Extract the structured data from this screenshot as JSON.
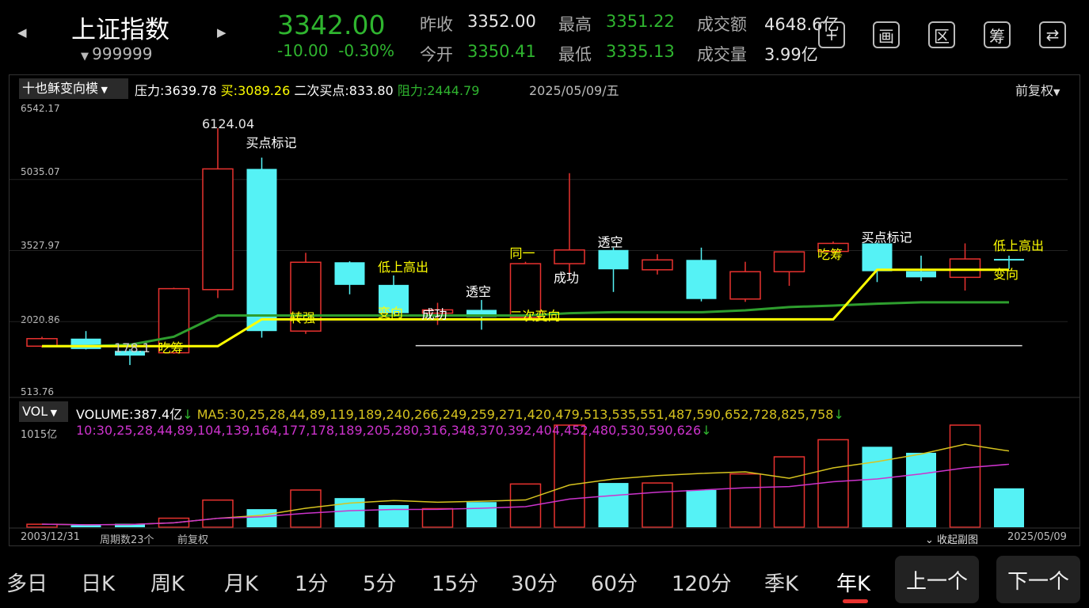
{
  "header": {
    "title": "上证指数",
    "code": "999999",
    "price": "3342.00",
    "change": "-10.00",
    "change_pct": "-0.30%",
    "prev_close_label": "昨收",
    "prev_close": "3352.00",
    "open_label": "今开",
    "open": "3350.41",
    "high_label": "最高",
    "high": "3351.22",
    "low_label": "最低",
    "low": "3335.13",
    "amount_label": "成交额",
    "amount": "4648.6亿",
    "volume_label": "成交量",
    "volume": "3.99亿",
    "toolbar_icons": [
      "plus-icon",
      "draw-icon",
      "range-icon",
      "chip-icon",
      "device-switch-icon"
    ],
    "toolbar_glyphs": [
      "+",
      "画",
      "区",
      "筹",
      "⇄"
    ]
  },
  "indicator": {
    "selector": "十也稣变向模",
    "pressure_label": "压力:",
    "pressure": "3639.78",
    "buy_label": "买:",
    "buy": "3089.26",
    "second_buy_label": "二次买点:",
    "second_buy": "833.80",
    "resistance_label": "阻力:",
    "resistance": "2444.79",
    "date": "2025/05/09/五",
    "adjust": "前复权"
  },
  "colors": {
    "up": "#e8322f",
    "down": "#55f2f5",
    "ma_green": "#2e9e2e",
    "yellow_line": "#ffff00",
    "ma5": "#d6c31f",
    "ma10": "#cc33cc"
  },
  "chart_data": [
    {
      "type": "candlestick",
      "title": "上证指数 年K",
      "y_ticks": [
        "6542.17",
        "5035.07",
        "3527.97",
        "2020.86",
        "513.76"
      ],
      "ylim": [
        513.76,
        6542.17
      ],
      "candles": [
        {
          "o": 1500,
          "c": 1660,
          "h": 1700,
          "l": 1470,
          "dir": "up"
        },
        {
          "o": 1660,
          "c": 1440,
          "h": 1820,
          "l": 1430,
          "dir": "down"
        },
        {
          "o": 1400,
          "c": 1300,
          "h": 1440,
          "l": 1100,
          "dir": "down"
        },
        {
          "o": 1360,
          "c": 2720,
          "h": 2740,
          "l": 1340,
          "dir": "up"
        },
        {
          "o": 2700,
          "c": 5260,
          "h": 6124,
          "l": 2520,
          "dir": "up"
        },
        {
          "o": 5260,
          "c": 1820,
          "h": 5500,
          "l": 1680,
          "dir": "down"
        },
        {
          "o": 1820,
          "c": 3280,
          "h": 3480,
          "l": 1760,
          "dir": "up"
        },
        {
          "o": 3280,
          "c": 2800,
          "h": 3300,
          "l": 2600,
          "dir": "down"
        },
        {
          "o": 2800,
          "c": 2200,
          "h": 3000,
          "l": 2140,
          "dir": "down"
        },
        {
          "o": 2200,
          "c": 2270,
          "h": 2420,
          "l": 1950,
          "dir": "up"
        },
        {
          "o": 2270,
          "c": 2120,
          "h": 2480,
          "l": 1850,
          "dir": "down"
        },
        {
          "o": 2110,
          "c": 3250,
          "h": 3290,
          "l": 2060,
          "dir": "up"
        },
        {
          "o": 3250,
          "c": 3540,
          "h": 5170,
          "l": 2950,
          "dir": "up"
        },
        {
          "o": 3540,
          "c": 3130,
          "h": 3590,
          "l": 2650,
          "dir": "down"
        },
        {
          "o": 3120,
          "c": 3330,
          "h": 3450,
          "l": 3020,
          "dir": "up"
        },
        {
          "o": 3330,
          "c": 2500,
          "h": 3590,
          "l": 2450,
          "dir": "down"
        },
        {
          "o": 2500,
          "c": 3080,
          "h": 3290,
          "l": 2440,
          "dir": "up"
        },
        {
          "o": 3080,
          "c": 3500,
          "h": 3500,
          "l": 2780,
          "dir": "up"
        },
        {
          "o": 3510,
          "c": 3680,
          "h": 3720,
          "l": 3460,
          "dir": "up"
        },
        {
          "o": 3680,
          "c": 3090,
          "h": 3700,
          "l": 2860,
          "dir": "down"
        },
        {
          "o": 3090,
          "c": 2960,
          "h": 3420,
          "l": 2880,
          "dir": "down"
        },
        {
          "o": 2960,
          "c": 3350,
          "h": 3680,
          "l": 2680,
          "dir": "up"
        },
        {
          "o": 3350,
          "c": 3342,
          "h": 3420,
          "l": 3140,
          "dir": "down"
        }
      ],
      "green_ma": [
        1500,
        1500,
        1530,
        1700,
        2150,
        2150,
        2150,
        2150,
        2150,
        2150,
        2150,
        2150,
        2200,
        2220,
        2220,
        2220,
        2260,
        2330,
        2360,
        2400,
        2430,
        2430,
        2430
      ],
      "yellow_line": [
        1500,
        1500,
        1500,
        1500,
        1500,
        2070,
        2070,
        2070,
        2070,
        2070,
        2070,
        2070,
        2070,
        2070,
        2070,
        2070,
        2070,
        2070,
        2070,
        3120,
        3120,
        3120,
        3120
      ],
      "signals": [
        {
          "i": 2,
          "text": "178.1",
          "color": "#cccccc",
          "value": 1370
        },
        {
          "i": 3,
          "text": "吃筹",
          "color": "#ffff00",
          "value": 1370
        },
        {
          "i": 4,
          "text": "6124.04",
          "color": "#e6e6e6",
          "value": 6124
        },
        {
          "i": 5,
          "text": "买点标记",
          "color": "#ffffff",
          "value": 5720
        },
        {
          "i": 6,
          "text": "转强",
          "color": "#ffff00",
          "value": 2010
        },
        {
          "i": 8,
          "text": "低上高出",
          "color": "#ffff00",
          "value": 3080
        },
        {
          "i": 8,
          "text": "变向",
          "color": "#ffff00",
          "value": 2120
        },
        {
          "i": 9,
          "text": "成功",
          "color": "#ffffff",
          "value": 2080
        },
        {
          "i": 10,
          "text": "透空",
          "color": "#ffffff",
          "value": 2560
        },
        {
          "i": 11,
          "text": "二次变向",
          "color": "#ffff00",
          "value": 2050
        },
        {
          "i": 11,
          "text": "同一",
          "color": "#ffff00",
          "value": 3380
        },
        {
          "i": 12,
          "text": "成功",
          "color": "#ffffff",
          "value": 2860
        },
        {
          "i": 13,
          "text": "透空",
          "color": "#ffffff",
          "value": 3610
        },
        {
          "i": 18,
          "text": "吃筹",
          "color": "#ffff00",
          "value": 3350
        },
        {
          "i": 19,
          "text": "买点标记",
          "color": "#ffffff",
          "value": 3710
        },
        {
          "i": 22,
          "text": "低上高出",
          "color": "#ffff00",
          "value": 3540
        },
        {
          "i": 22,
          "text": "变向",
          "color": "#ffff00",
          "value": 2930
        }
      ]
    },
    {
      "type": "bar",
      "title": "VOL",
      "volume_label": "VOLUME:",
      "volume": "387.4亿",
      "ma5_label": "MA5:",
      "ma5": [
        30,
        25,
        28,
        44,
        89,
        119,
        189,
        240,
        266,
        249,
        259,
        271,
        420,
        479,
        513,
        535,
        551,
        487,
        590,
        652,
        728,
        825,
        758
      ],
      "ma10_label": "10:",
      "ma10": [
        30,
        25,
        28,
        44,
        89,
        104,
        139,
        164,
        177,
        178,
        189,
        205,
        280,
        316,
        348,
        370,
        392,
        404,
        452,
        480,
        530,
        590,
        626
      ],
      "y_tick": "1015亿",
      "ylim": [
        0,
        1015
      ],
      "values": [
        30,
        20,
        35,
        90,
        270,
        180,
        370,
        290,
        220,
        185,
        250,
        430,
        1015,
        440,
        440,
        370,
        530,
        700,
        870,
        800,
        740,
        1015,
        387
      ]
    }
  ],
  "chart_footer": {
    "start_date": "2003/12/31",
    "period_count": "周期数23个",
    "adjust": "前复权",
    "collapse": "收起副图",
    "end_date": "2025/05/09"
  },
  "tabs": [
    "多日",
    "日K",
    "周K",
    "月K",
    "1分",
    "5分",
    "15分",
    "30分",
    "60分",
    "120分",
    "季K",
    "年K"
  ],
  "active_tab": "年K",
  "nav": {
    "prev": "上一个",
    "next": "下一个"
  }
}
